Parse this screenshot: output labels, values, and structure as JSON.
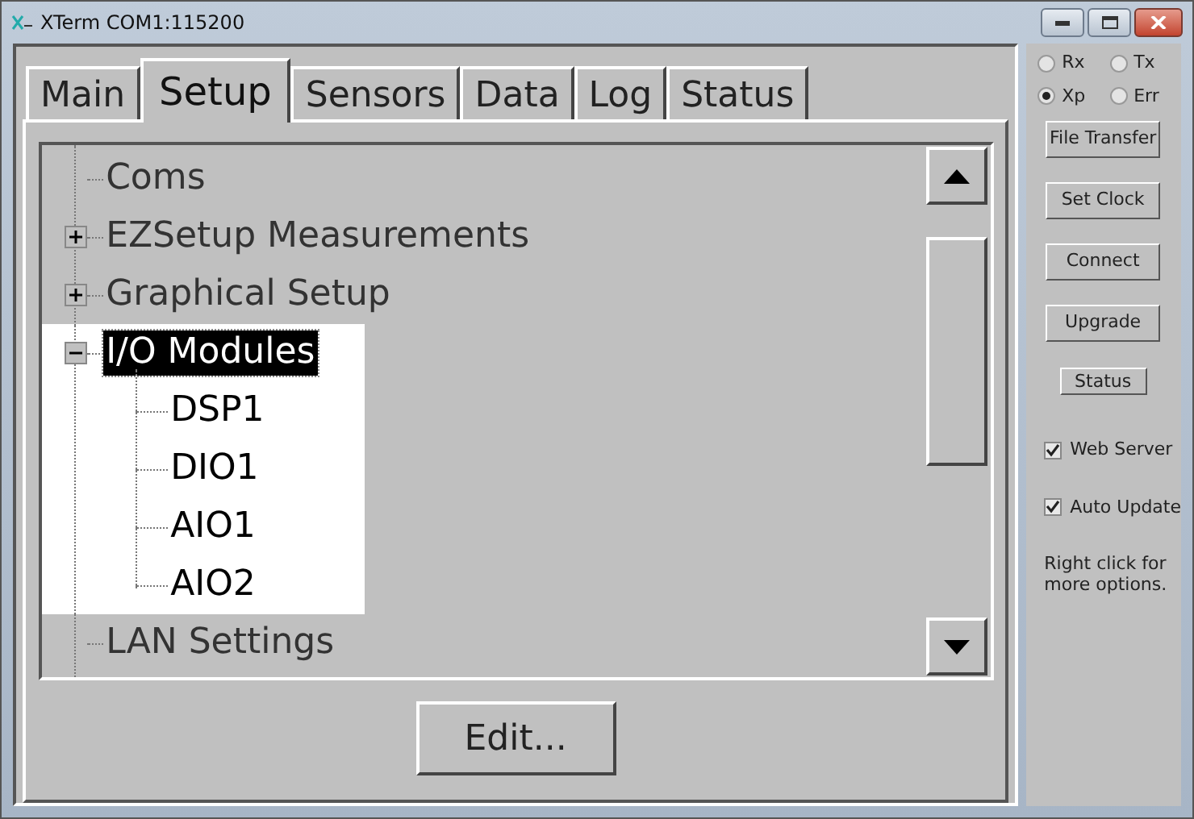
{
  "window": {
    "title": "XTerm COM1:115200"
  },
  "tabs": [
    {
      "label": "Main",
      "selected": false
    },
    {
      "label": "Setup",
      "selected": true
    },
    {
      "label": "Sensors",
      "selected": false
    },
    {
      "label": "Data",
      "selected": false
    },
    {
      "label": "Log",
      "selected": false
    },
    {
      "label": "Status",
      "selected": false
    }
  ],
  "tree": {
    "items": [
      {
        "label": "Coms",
        "selected": false
      },
      {
        "label": "EZSetup Measurements",
        "selected": false,
        "expanded": false
      },
      {
        "label": "Graphical Setup",
        "selected": false,
        "expanded": false
      },
      {
        "label": "I/O Modules",
        "selected": true,
        "expanded": true,
        "children": [
          {
            "label": "DSP1",
            "selected": false
          },
          {
            "label": "DIO1",
            "selected": false
          },
          {
            "label": "AIO1",
            "selected": false
          },
          {
            "label": "AIO2",
            "selected": false
          }
        ]
      },
      {
        "label": "LAN Settings",
        "selected": false
      }
    ]
  },
  "edit_button": "Edit...",
  "indicators": [
    {
      "label": "Rx",
      "selected": false
    },
    {
      "label": "Tx",
      "selected": false
    },
    {
      "label": "Xp",
      "selected": true
    },
    {
      "label": "Err",
      "selected": false
    }
  ],
  "buttons": [
    {
      "label": "File Transfer"
    },
    {
      "label": "Set Clock"
    },
    {
      "label": "Connect"
    },
    {
      "label": "Upgrade"
    },
    {
      "label": "Status",
      "kind": "small"
    }
  ],
  "checkboxes": [
    {
      "label": "Web Server",
      "checked": true
    },
    {
      "label": "Auto Update",
      "checked": true
    }
  ],
  "hint": "Right click for more options."
}
